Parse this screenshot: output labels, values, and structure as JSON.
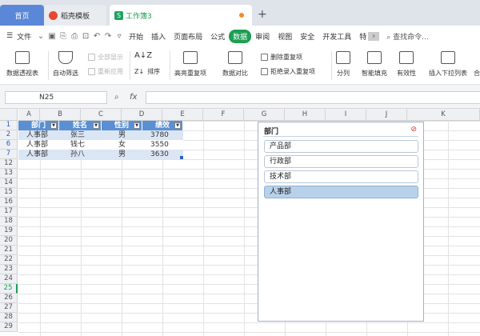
{
  "tabs": {
    "home": "首页",
    "template": "稻壳模板",
    "workbook": "工作簿3",
    "workbook_icon": "S"
  },
  "menu": {
    "file": "文件",
    "items": [
      "开始",
      "插入",
      "页面布局",
      "公式",
      "数据",
      "审阅",
      "视图",
      "安全",
      "开发工具",
      "特"
    ],
    "active": "数据",
    "search": "查找命令..."
  },
  "ribbon": {
    "pivot": "数据透视表",
    "autofilter": "自动筛选",
    "show_all": "全部显示",
    "reapply": "重新应用",
    "sort": "排序",
    "highlight_dup": "高亮重复项",
    "compare": "数据对比",
    "remove_dup": "删除重复项",
    "reject_dup": "拒绝录入重复项",
    "split": "分列",
    "smart_fill": "智能填充",
    "validity": "有效性",
    "dropdown": "插入下拉列表",
    "more": "合"
  },
  "formula_bar": {
    "name_box": "N25",
    "fx": "fx"
  },
  "columns": [
    "A",
    "B",
    "C",
    "D",
    "E",
    "F",
    "G",
    "H",
    "I",
    "J",
    "K"
  ],
  "rows": [
    "1",
    "2",
    "6",
    "7",
    "12",
    "13",
    "14",
    "15",
    "16",
    "17",
    "18",
    "19",
    "20",
    "21",
    "22",
    "23",
    "24",
    "25",
    "26",
    "27",
    "28",
    "29"
  ],
  "table": {
    "headers": [
      "部门",
      "姓名",
      "性别",
      "绩效"
    ],
    "data": [
      [
        "人事部",
        "张三",
        "男",
        "3780"
      ],
      [
        "人事部",
        "钱七",
        "女",
        "3550"
      ],
      [
        "人事部",
        "孙八",
        "男",
        "3630"
      ]
    ]
  },
  "slicer": {
    "title": "部门",
    "items": [
      "产品部",
      "行政部",
      "技术部",
      "人事部"
    ],
    "selected": "人事部"
  },
  "colors": {
    "accent": "#1d9e54",
    "table_header": "#5b8fd3",
    "table_band": "#dbe6f5",
    "slicer_selected": "#b8d1ea"
  }
}
